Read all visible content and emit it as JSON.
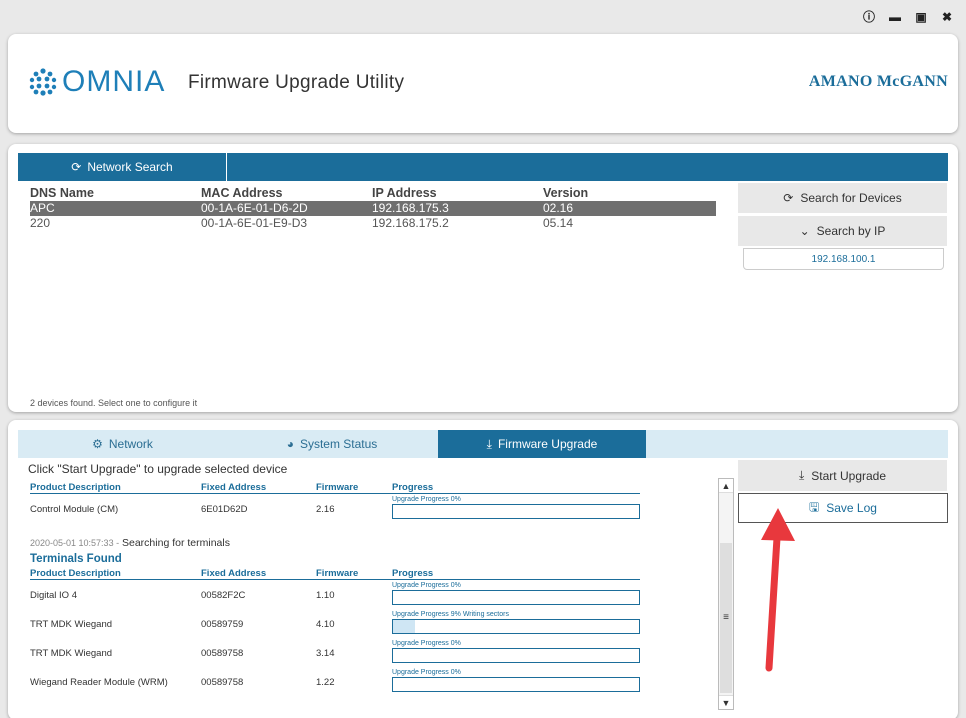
{
  "window_controls": [
    "info-icon",
    "minimize-icon",
    "maximize-icon",
    "close-icon"
  ],
  "header": {
    "logo_text": "OMNIA",
    "title": "Firmware Upgrade Utility",
    "brand": "AMANO McGANN"
  },
  "network": {
    "tab_label": "Network Search",
    "columns": [
      "DNS Name",
      "MAC Address",
      "IP Address",
      "Version"
    ],
    "devices": [
      {
        "dns": "APC",
        "mac": "00-1A-6E-01-D6-2D",
        "ip": "192.168.175.3",
        "version": "02.16"
      },
      {
        "dns": "220",
        "mac": "00-1A-6E-01-E9-D3",
        "ip": "192.168.175.2",
        "version": "05.14"
      }
    ],
    "search_devices_label": "Search for Devices",
    "search_ip_label": "Search by IP",
    "ip_value": "192.168.100.1",
    "status": "2 devices found. Select one to configure it"
  },
  "upgrade": {
    "tabs": [
      "Network",
      "System Status",
      "Firmware Upgrade"
    ],
    "instruction": "Click \"Start Upgrade\" to upgrade selected device",
    "columns": [
      "Product Description",
      "Fixed Address",
      "Firmware",
      "Progress"
    ],
    "controller": {
      "desc": "Control Module (CM)",
      "addr": "6E01D62D",
      "fw": "2.16",
      "progress_label": "Upgrade Progress 0%",
      "progress": 0
    },
    "log_timestamp": "2020-05-01 10:57:33 -",
    "log_message": "Searching for terminals",
    "terminals_title": "Terminals Found",
    "terminals": [
      {
        "desc": "Digital IO 4",
        "addr": "00582F2C",
        "fw": "1.10",
        "progress_label": "Upgrade Progress 0%",
        "progress": 0
      },
      {
        "desc": "TRT MDK Wiegand",
        "addr": "00589759",
        "fw": "4.10",
        "progress_label": "Upgrade Progress 9%   Writing sectors",
        "progress": 9
      },
      {
        "desc": "TRT MDK Wiegand",
        "addr": "00589758",
        "fw": "3.14",
        "progress_label": "Upgrade Progress 0%",
        "progress": 0
      },
      {
        "desc": "Wiegand Reader Module (WRM)",
        "addr": "00589758",
        "fw": "1.22",
        "progress_label": "Upgrade Progress 0%",
        "progress": 0
      }
    ],
    "start_label": "Start Upgrade",
    "save_log_label": "Save Log"
  },
  "colors": {
    "accent": "#1b6d9a",
    "arrow": "#e8383d",
    "tab_inactive": "#d9ebf4"
  }
}
